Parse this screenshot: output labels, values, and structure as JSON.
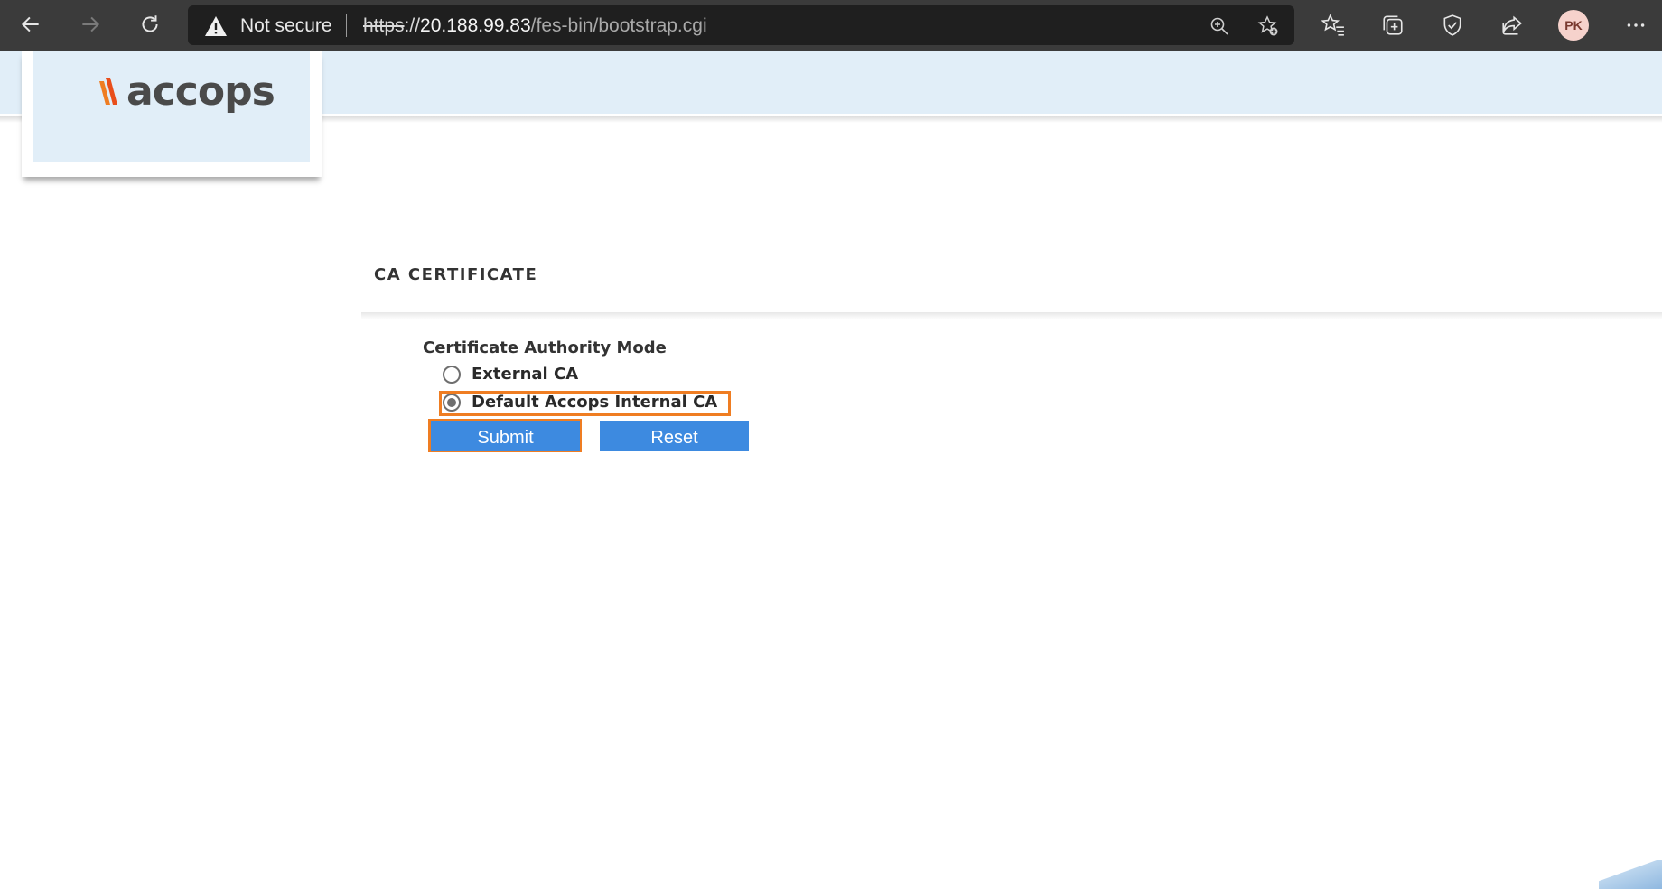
{
  "browser": {
    "security_label": "Not secure",
    "url": {
      "scheme": "https",
      "separator": "://",
      "host": "20.188.99.83",
      "path": "/fes-bin/bootstrap.cgi"
    },
    "profile_initials": "PK",
    "icons": [
      "back-icon",
      "forward-icon",
      "refresh-icon",
      "warning-icon",
      "zoom-icon",
      "add-favorite-icon",
      "favorites-icon",
      "collections-icon",
      "browser-essentials-icon",
      "share-icon",
      "more-icon"
    ]
  },
  "header": {
    "logo_text": "accops",
    "brand_color": "#ef7d22",
    "band_color": "#e1eef8"
  },
  "form": {
    "section_title": "CA CERTIFICATE",
    "field_label": "Certificate Authority Mode",
    "options": [
      {
        "label": "External CA",
        "selected": false
      },
      {
        "label": "Default Accops Internal CA",
        "selected": true
      }
    ],
    "submit_label": "Submit",
    "reset_label": "Reset",
    "button_color": "#3d8ae0",
    "highlight_color": "#ef7d22"
  }
}
